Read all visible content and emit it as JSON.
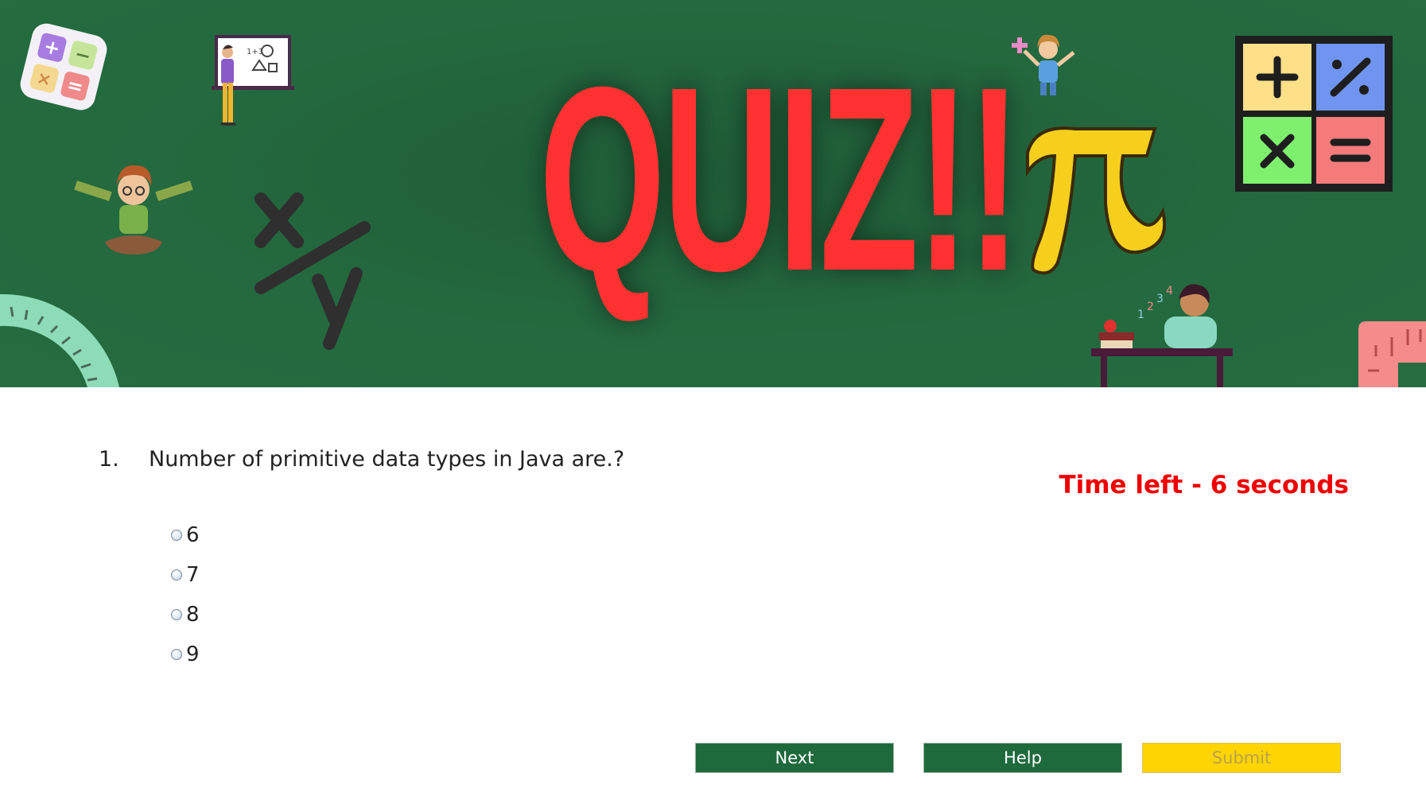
{
  "banner": {
    "title": "QUIZ!!",
    "icons": [
      "calculator-icon",
      "teacher-whiteboard-icon",
      "child-with-ruler-icon",
      "x-over-y-icon",
      "protractor-icon",
      "girl-with-plus-icon",
      "pi-symbol-icon",
      "math-operators-grid-icon",
      "student-at-desk-icon",
      "ruler-icon"
    ],
    "colors": {
      "background": "#24693f",
      "title": "#ff3131"
    }
  },
  "question": {
    "number": "1.",
    "text": "Number of primitive data types in Java are.?",
    "options": [
      "6",
      "7",
      "8",
      "9"
    ]
  },
  "timer": {
    "text": "Time left - 6 seconds",
    "color": "#ee0000"
  },
  "buttons": {
    "next_label": "Next",
    "help_label": "Help",
    "submit_label": "Submit"
  }
}
